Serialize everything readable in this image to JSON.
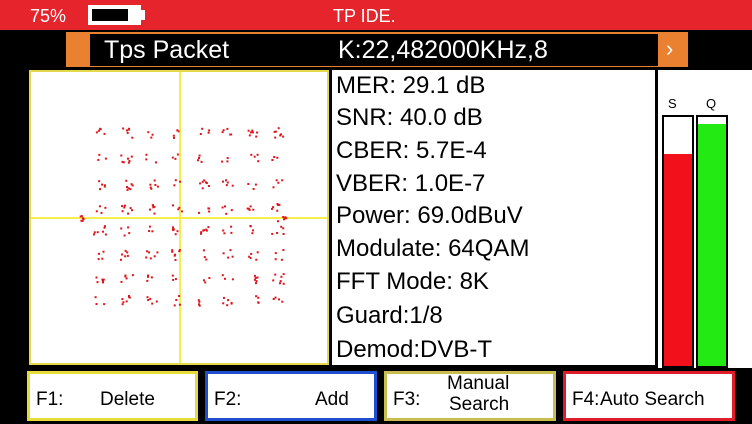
{
  "status": {
    "battery_percent": "75%",
    "battery_level": 0.8,
    "title": "TP IDE."
  },
  "tp": {
    "label": "Tps Packet",
    "value": "K:22,482000KHz,8",
    "arrow": "›"
  },
  "constellation": {
    "icon": "constellation-diagram",
    "point_color": "#e1141b",
    "axis_color": "#f5ee4b"
  },
  "info": [
    "MER: 29.1 dB",
    "SNR: 40.0 dB",
    "CBER: 5.7E-4",
    "VBER: 1.0E-7",
    "Power: 69.0dBuV",
    "Modulate: 64QAM",
    "FFT Mode: 8K",
    "Guard:1/8",
    "Demod:DVB-T"
  ],
  "meters": {
    "s": {
      "label": "S",
      "level": 0.85,
      "color": "#f2101a"
    },
    "q": {
      "label": "Q",
      "level": 0.97,
      "color": "#22ea12"
    }
  },
  "fkeys": [
    {
      "key": "F1:",
      "label": "Delete",
      "color": "#e5db3d"
    },
    {
      "key": "F2:",
      "label": "Add",
      "color": "#1f4fd0"
    },
    {
      "key": "F3:",
      "label_line1": "Manual",
      "label_line2": "Search",
      "color": "#c9bd4f"
    },
    {
      "key": "F4:",
      "label": "Auto Search",
      "color": "#e01e2a"
    }
  ]
}
